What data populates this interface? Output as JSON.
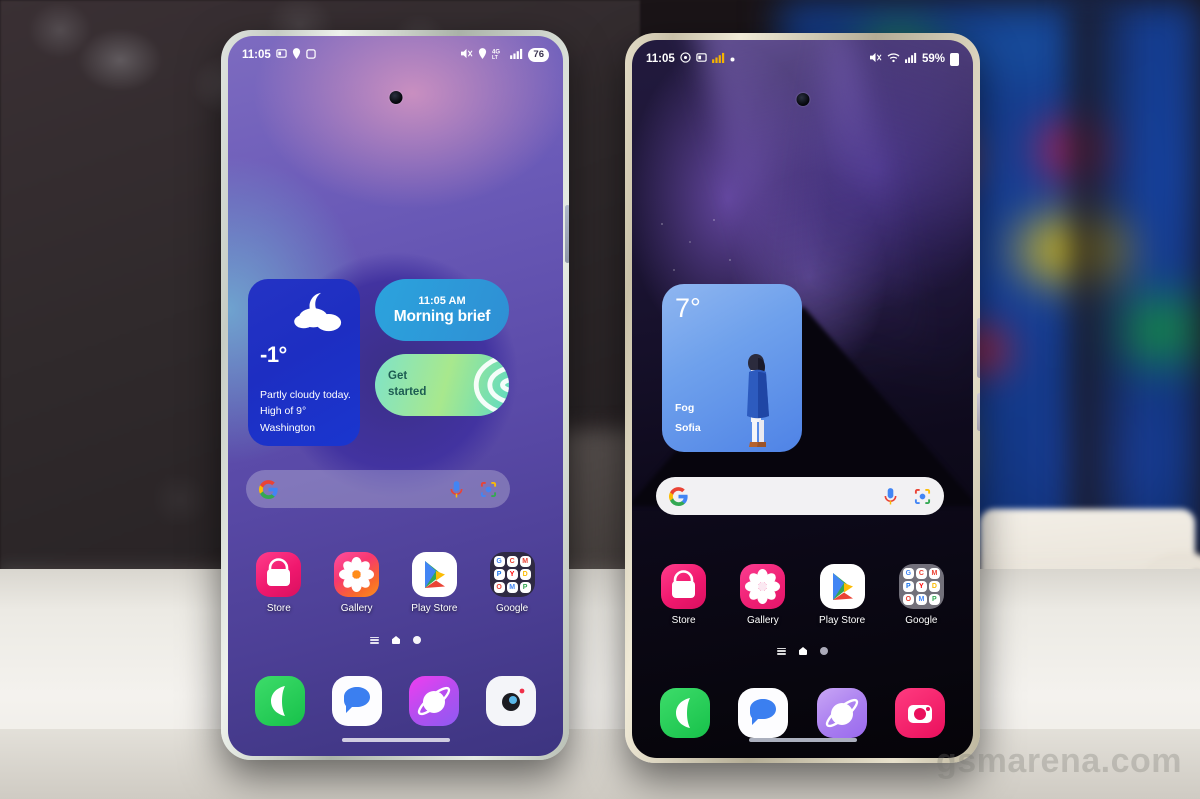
{
  "watermark": "gsmarena.com",
  "left_phone": {
    "name": "Samsung Galaxy S-series phone (silver-green frame)",
    "status_bar": {
      "time": "11:05",
      "icons": [
        "screenshot-icon",
        "location-pin-icon",
        "square-icon"
      ],
      "right_icons": [
        "mute-icon",
        "location-icon",
        "4g-lte-icon",
        "signal-bars-icon"
      ],
      "battery": "76"
    },
    "weather_widget": {
      "temperature": "-1°",
      "condition": "Partly cloudy today.",
      "high": "High of 9°",
      "location": "Washington",
      "icon": "moon-cloud-icon"
    },
    "brief_widget": {
      "time": "11:05 AM",
      "title": "Morning brief"
    },
    "get_started_widget": {
      "label": "Get\nstarted",
      "line1": "Get",
      "line2": "started"
    },
    "search": {
      "placeholder": "",
      "logo": "google-g-icon",
      "mic": "microphone-icon",
      "lens": "google-lens-icon"
    },
    "apps": [
      {
        "label": "Store",
        "icon": "galaxy-store-icon"
      },
      {
        "label": "Gallery",
        "icon": "gallery-flower-icon"
      },
      {
        "label": "Play Store",
        "icon": "play-store-icon"
      },
      {
        "label": "Google",
        "icon": "google-folder-icon"
      }
    ],
    "folder_apps": [
      "G",
      "C",
      "M",
      "M",
      "Y",
      "D",
      "P",
      "K",
      "P"
    ],
    "page_indicator": {
      "items": [
        "menu-icon",
        "home-icon",
        "page-dot"
      ],
      "active": 2
    },
    "dock": [
      {
        "icon": "phone-icon",
        "label": "Phone"
      },
      {
        "icon": "messages-icon",
        "label": "Messages"
      },
      {
        "icon": "internet-browser-icon",
        "label": "Internet"
      },
      {
        "icon": "camera-icon",
        "label": "Camera"
      }
    ]
  },
  "right_phone": {
    "name": "Samsung Galaxy Ultra phone (beige/titanium frame)",
    "status_bar": {
      "time": "11:05",
      "icons": [
        "alarm-icon",
        "screenshot-icon",
        "signal-bars-icon",
        "dot-icon"
      ],
      "right_icons": [
        "mute-icon",
        "wifi-icon",
        "signal-bars-icon"
      ],
      "battery": "59%"
    },
    "weather_widget": {
      "temperature": "7°",
      "condition": "Fog",
      "location": "Sofia",
      "illustration": "person-in-blue-coat-illustration"
    },
    "search": {
      "placeholder": "",
      "logo": "google-g-icon",
      "mic": "microphone-icon",
      "lens": "google-lens-icon"
    },
    "apps": [
      {
        "label": "Store",
        "icon": "galaxy-store-icon"
      },
      {
        "label": "Gallery",
        "icon": "gallery-flower-icon"
      },
      {
        "label": "Play Store",
        "icon": "play-store-icon"
      },
      {
        "label": "Google",
        "icon": "google-folder-icon"
      }
    ],
    "folder_apps": [
      "G",
      "C",
      "M",
      "M",
      "Y",
      "D",
      "P",
      "K",
      "P"
    ],
    "page_indicator": {
      "items": [
        "menu-icon",
        "home-icon",
        "page-dot"
      ],
      "active": 2
    },
    "dock": [
      {
        "icon": "phone-icon",
        "label": "Phone"
      },
      {
        "icon": "messages-icon",
        "label": "Messages"
      },
      {
        "icon": "internet-browser-icon",
        "label": "Internet"
      },
      {
        "icon": "camera-icon",
        "label": "Camera"
      }
    ]
  },
  "colors": {
    "left_widget_blue": "#1d2ec2",
    "brief_blue": "#2ba3dd",
    "get_started_green": "#7fe3c8",
    "right_widget_blue": "#6fa1ec",
    "store_pink": "#f0186e",
    "phone_green": "#17c14a"
  }
}
